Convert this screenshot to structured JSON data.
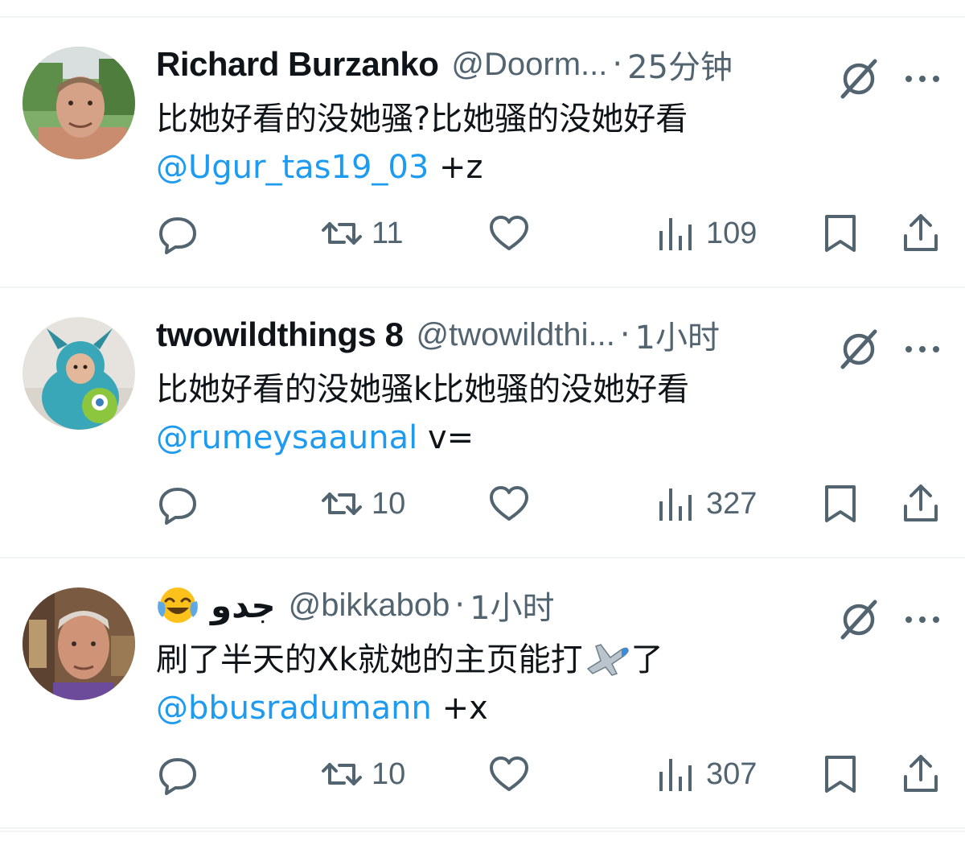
{
  "colors": {
    "text_primary": "#0f1419",
    "text_secondary": "#536471",
    "mention": "#1d9bf0",
    "divider": "#eff3f4"
  },
  "tweets": [
    {
      "display_name": "Richard Burzanko",
      "handle": "@Doorm...",
      "separator": "·",
      "time": "25分钟",
      "body_line1": "比她好看的没她骚?比她骚的没她好看",
      "mention": "@Ugur_tas19_03",
      "mention_suffix": " +z",
      "retweets": "11",
      "views": "109"
    },
    {
      "display_name": "twowildthings 8",
      "handle": "@twowildthi...",
      "separator": "·",
      "time": "1小时",
      "body_line1": "比她好看的没她骚k比她骚的没她好看",
      "mention": "@rumeysaaunal",
      "mention_suffix": " v=",
      "retweets": "10",
      "views": "327"
    },
    {
      "display_name": "جدو",
      "handle": "@bikkabob",
      "separator": "·",
      "time": "1小时",
      "body_line1_before_emoji": "刷了半天的Xk就她的主页能打",
      "body_line1_after_emoji": "了",
      "mention": "@bbusradumann",
      "mention_suffix": " +x",
      "retweets": "10",
      "views": "307"
    }
  ],
  "icons": {
    "reply": "reply-icon",
    "retweet": "retweet-icon",
    "like": "heart-icon",
    "views": "views-chart-icon",
    "bookmark": "bookmark-icon",
    "share": "share-icon",
    "grok": "grok-icon",
    "more": "more-dots-icon"
  }
}
